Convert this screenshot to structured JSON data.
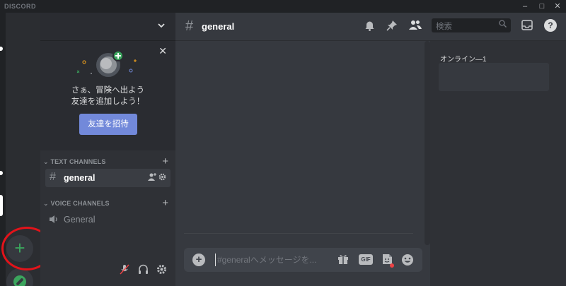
{
  "window": {
    "brand": "DISCORD",
    "controls": [
      "–",
      "□",
      "✕"
    ]
  },
  "server_rail": {
    "add_server_glyph": "+",
    "explore_icon": "compass-icon"
  },
  "sidebar": {
    "invite_card": {
      "line1": "さぁ、冒険へ出よう",
      "line2": "友達を追加しよう！",
      "button_label": "友達を招待"
    },
    "categories": [
      {
        "label": "TEXT CHANNELS"
      },
      {
        "label": "VOICE CHANNELS"
      }
    ],
    "text_channel": {
      "name": "general"
    },
    "voice_channel": {
      "name": "General"
    }
  },
  "chat": {
    "channel_name": "general",
    "search_placeholder": "検索",
    "message_placeholder": "#generalへメッセージを...",
    "gif_label": "GIF"
  },
  "members": {
    "online_label": "オンライン—1"
  },
  "colors": {
    "accent": "#7289da",
    "green": "#3ba55d",
    "highlight_circle": "#e3131a",
    "notification_dot": "#ed4245"
  }
}
